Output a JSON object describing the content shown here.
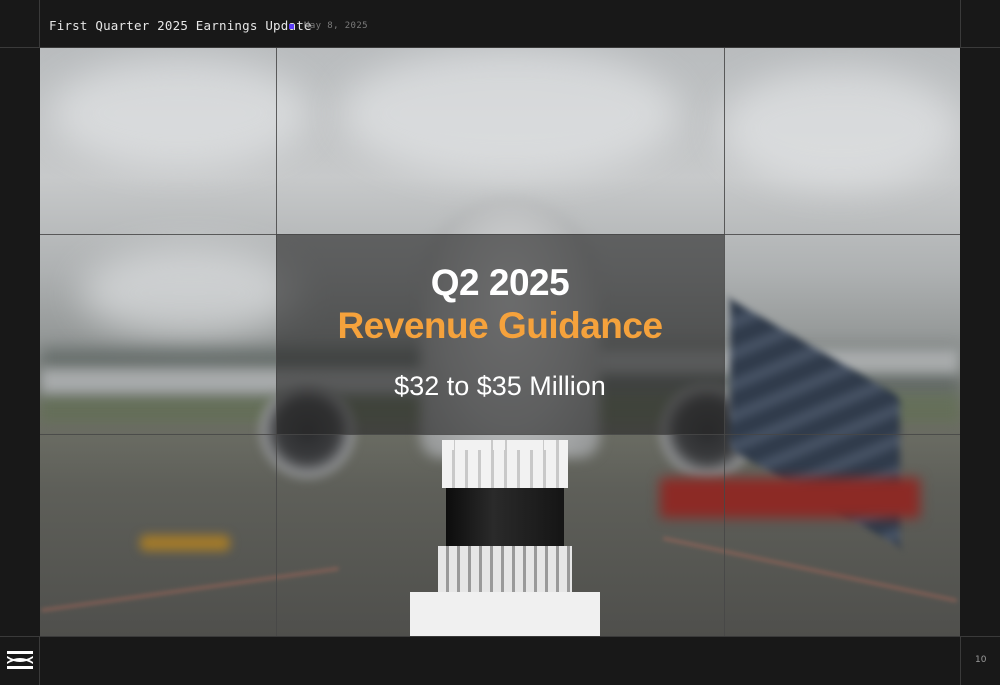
{
  "header": {
    "title": "First Quarter 2025 Earnings Update",
    "date": "May 8, 2025",
    "accent_color": "#5b3df5"
  },
  "slide": {
    "heading_line1": "Q2 2025",
    "heading_line2": "Revenue Guidance",
    "amount": "$32 to $35 Million",
    "heading_color": "#ffffff",
    "highlight_color": "#f5a23c"
  },
  "footer": {
    "logo_icon": "company-logo-icon",
    "page_number": "10"
  }
}
